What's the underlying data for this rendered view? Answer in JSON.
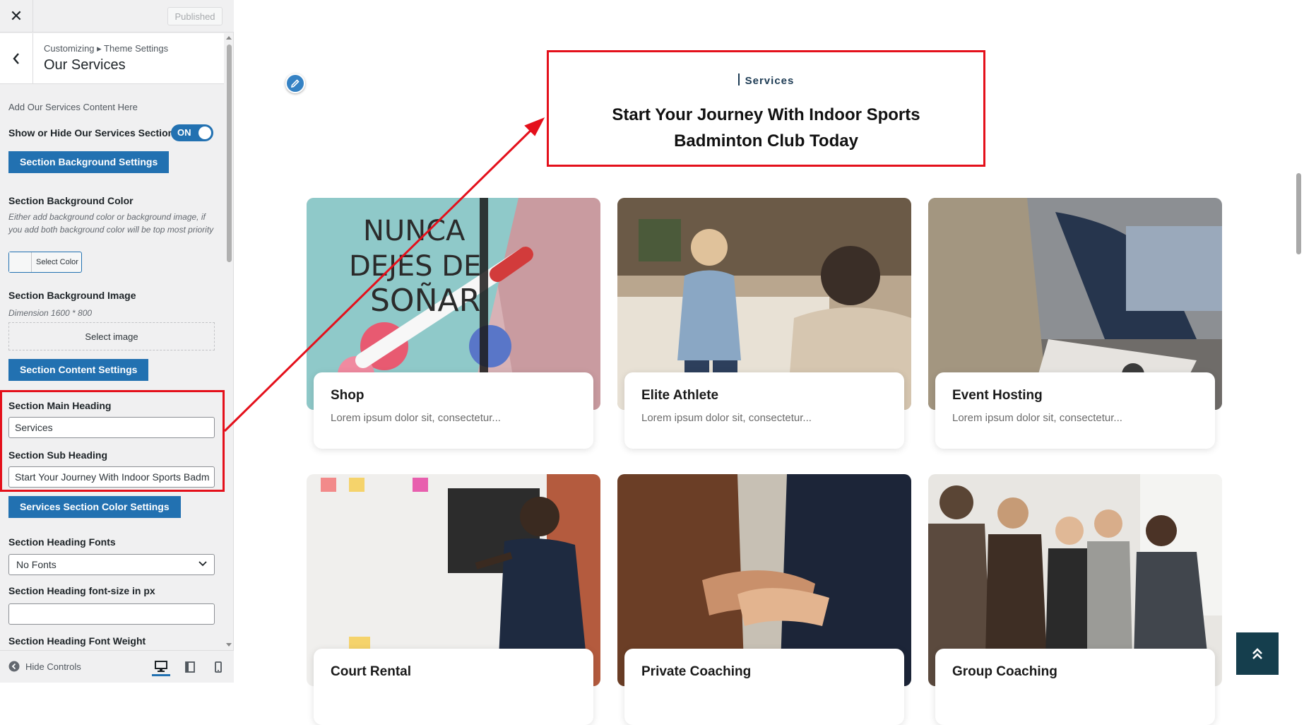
{
  "sidebar": {
    "published_label": "Published",
    "breadcrumb": "Customizing ▸ Theme Settings",
    "panel_title": "Our Services",
    "intro_text": "Add Our Services Content Here",
    "toggle_label": "Show or Hide Our Services Section",
    "toggle_state": "ON",
    "bg_settings_button": "Section Background Settings",
    "bg_color_label": "Section Background Color",
    "bg_color_desc": "Either add background color or background image, if you add both background color will be top most priority",
    "select_color_label": "Select Color",
    "bg_image_label": "Section Background Image",
    "bg_image_desc": "Dimension 1600 * 800",
    "select_image_label": "Select image",
    "content_settings_button": "Section Content Settings",
    "main_heading_label": "Section Main Heading",
    "main_heading_value": "Services",
    "sub_heading_label": "Section Sub Heading",
    "sub_heading_value": "Start Your Journey With Indoor Sports Badm",
    "color_settings_button": "Services Section Color Settings",
    "heading_fonts_label": "Section Heading Fonts",
    "heading_fonts_value": "No Fonts",
    "font_size_label": "Section Heading font-size in px",
    "font_size_value": "",
    "font_weight_label": "Section Heading Font Weight",
    "hide_controls_label": "Hide Controls"
  },
  "preview": {
    "section_tag": "Services",
    "heading_line1": "Start Your Journey With Indoor Sports",
    "heading_line2": "Badminton Club Today",
    "cards": [
      {
        "title": "Shop",
        "desc": "Lorem ipsum dolor sit, consectetur..."
      },
      {
        "title": "Elite Athlete",
        "desc": "Lorem ipsum dolor sit, consectetur..."
      },
      {
        "title": "Event Hosting",
        "desc": "Lorem ipsum dolor sit, consectetur..."
      },
      {
        "title": "Court Rental",
        "desc": ""
      },
      {
        "title": "Private Coaching",
        "desc": ""
      },
      {
        "title": "Group Coaching",
        "desc": ""
      }
    ]
  },
  "colors": {
    "accent": "#2271b1",
    "annotation_red": "#e4101b",
    "scroll_top_bg": "#153e4d"
  },
  "icons": [
    "close-icon",
    "chevron-left-icon",
    "pencil-icon",
    "chevron-down-icon",
    "eye-icon",
    "desktop-icon",
    "tablet-icon",
    "mobile-icon",
    "double-chevron-up-icon"
  ]
}
